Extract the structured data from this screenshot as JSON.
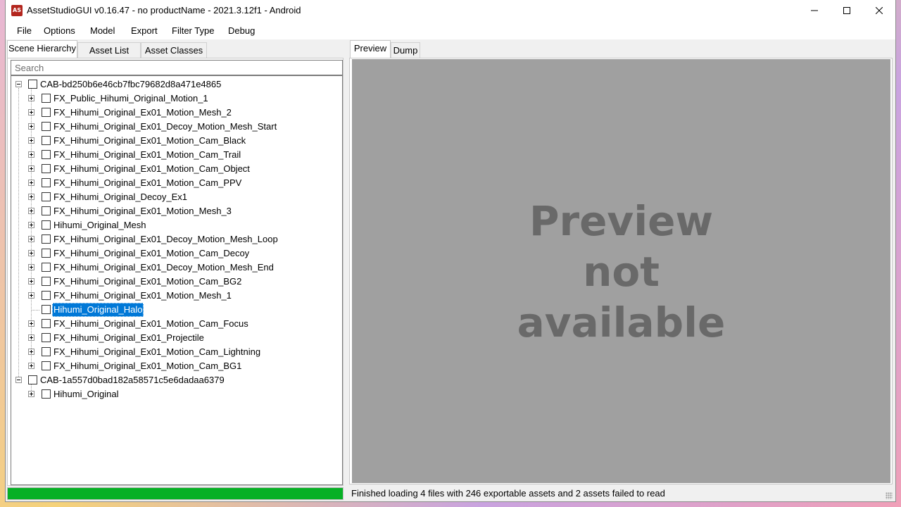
{
  "window": {
    "title": "AssetStudioGUI v0.16.47 - no productName - 2021.3.12f1 - Android",
    "app_icon_text": "AS",
    "controls": [
      "minimize-icon",
      "maximize-icon",
      "close-icon"
    ]
  },
  "menu": [
    "File",
    "Options",
    "Model",
    "Export",
    "Filter Type",
    "Debug"
  ],
  "left_tabs": [
    "Scene Hierarchy",
    "Asset List",
    "Asset Classes"
  ],
  "left_active_tab": "Scene Hierarchy",
  "search": {
    "placeholder": "Search",
    "value": ""
  },
  "tree": {
    "roots": [
      {
        "label": "CAB-bd250b6e46cb7fbc79682d8a471e4865",
        "expanded": true,
        "children": [
          "FX_Public_Hihumi_Original_Motion_1",
          "FX_Hihumi_Original_Ex01_Motion_Mesh_2",
          "FX_Hihumi_Original_Ex01_Decoy_Motion_Mesh_Start",
          "FX_Hihumi_Original_Ex01_Motion_Cam_Black",
          "FX_Hihumi_Original_Ex01_Motion_Cam_Trail",
          "FX_Hihumi_Original_Ex01_Motion_Cam_Object",
          "FX_Hihumi_Original_Ex01_Motion_Cam_PPV",
          "FX_Hihumi_Original_Decoy_Ex1",
          "FX_Hihumi_Original_Ex01_Motion_Mesh_3",
          "Hihumi_Original_Mesh",
          "FX_Hihumi_Original_Ex01_Decoy_Motion_Mesh_Loop",
          "FX_Hihumi_Original_Ex01_Motion_Cam_Decoy",
          "FX_Hihumi_Original_Ex01_Decoy_Motion_Mesh_End",
          "FX_Hihumi_Original_Ex01_Motion_Cam_BG2",
          "FX_Hihumi_Original_Ex01_Motion_Mesh_1",
          "Hihumi_Original_Halo",
          "FX_Hihumi_Original_Ex01_Motion_Cam_Focus",
          "FX_Hihumi_Original_Ex01_Projectile",
          "FX_Hihumi_Original_Ex01_Motion_Cam_Lightning",
          "FX_Hihumi_Original_Ex01_Motion_Cam_BG1"
        ]
      },
      {
        "label": "CAB-1a557d0bad182a58571c5e6dadaa6379",
        "expanded": true,
        "children": [
          "Hihumi_Original"
        ]
      }
    ],
    "selected": "Hihumi_Original_Halo",
    "leaf_items": [
      "Hihumi_Original_Halo"
    ]
  },
  "progress": {
    "fraction": 1.0,
    "color": "#06b025"
  },
  "right_tabs": [
    "Preview",
    "Dump"
  ],
  "right_active_tab": "Preview",
  "preview": {
    "lines": [
      "Preview",
      "not",
      "available"
    ]
  },
  "status": "Finished loading 4 files with 246 exportable assets and 2 assets failed to read",
  "colors": {
    "selection": "#0078d7",
    "preview_bg": "#a0a0a0",
    "preview_text": "#696969"
  }
}
